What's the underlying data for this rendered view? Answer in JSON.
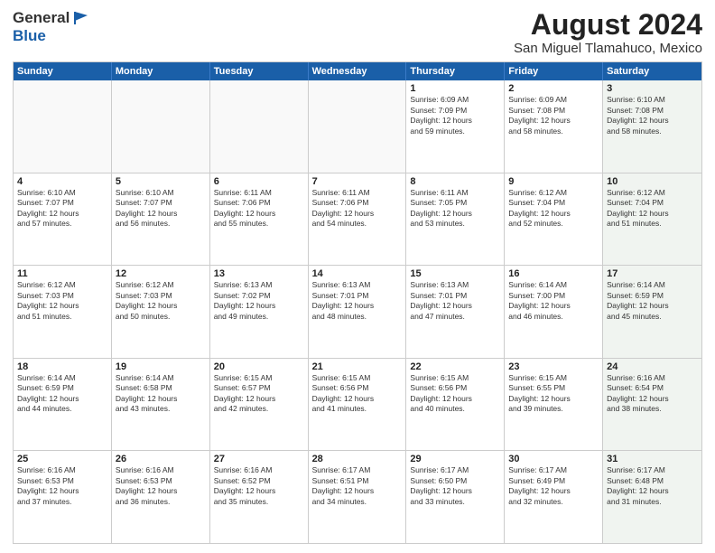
{
  "header": {
    "logo_general": "General",
    "logo_blue": "Blue",
    "main_title": "August 2024",
    "sub_title": "San Miguel Tlamahuco, Mexico"
  },
  "calendar": {
    "days_of_week": [
      "Sunday",
      "Monday",
      "Tuesday",
      "Wednesday",
      "Thursday",
      "Friday",
      "Saturday"
    ],
    "weeks": [
      [
        {
          "day": "",
          "info": "",
          "empty": true
        },
        {
          "day": "",
          "info": "",
          "empty": true
        },
        {
          "day": "",
          "info": "",
          "empty": true
        },
        {
          "day": "",
          "info": "",
          "empty": true
        },
        {
          "day": "1",
          "info": "Sunrise: 6:09 AM\nSunset: 7:09 PM\nDaylight: 12 hours\nand 59 minutes.",
          "empty": false
        },
        {
          "day": "2",
          "info": "Sunrise: 6:09 AM\nSunset: 7:08 PM\nDaylight: 12 hours\nand 58 minutes.",
          "empty": false
        },
        {
          "day": "3",
          "info": "Sunrise: 6:10 AM\nSunset: 7:08 PM\nDaylight: 12 hours\nand 58 minutes.",
          "empty": false,
          "shaded": true
        }
      ],
      [
        {
          "day": "4",
          "info": "Sunrise: 6:10 AM\nSunset: 7:07 PM\nDaylight: 12 hours\nand 57 minutes.",
          "empty": false
        },
        {
          "day": "5",
          "info": "Sunrise: 6:10 AM\nSunset: 7:07 PM\nDaylight: 12 hours\nand 56 minutes.",
          "empty": false
        },
        {
          "day": "6",
          "info": "Sunrise: 6:11 AM\nSunset: 7:06 PM\nDaylight: 12 hours\nand 55 minutes.",
          "empty": false
        },
        {
          "day": "7",
          "info": "Sunrise: 6:11 AM\nSunset: 7:06 PM\nDaylight: 12 hours\nand 54 minutes.",
          "empty": false
        },
        {
          "day": "8",
          "info": "Sunrise: 6:11 AM\nSunset: 7:05 PM\nDaylight: 12 hours\nand 53 minutes.",
          "empty": false
        },
        {
          "day": "9",
          "info": "Sunrise: 6:12 AM\nSunset: 7:04 PM\nDaylight: 12 hours\nand 52 minutes.",
          "empty": false
        },
        {
          "day": "10",
          "info": "Sunrise: 6:12 AM\nSunset: 7:04 PM\nDaylight: 12 hours\nand 51 minutes.",
          "empty": false,
          "shaded": true
        }
      ],
      [
        {
          "day": "11",
          "info": "Sunrise: 6:12 AM\nSunset: 7:03 PM\nDaylight: 12 hours\nand 51 minutes.",
          "empty": false
        },
        {
          "day": "12",
          "info": "Sunrise: 6:12 AM\nSunset: 7:03 PM\nDaylight: 12 hours\nand 50 minutes.",
          "empty": false
        },
        {
          "day": "13",
          "info": "Sunrise: 6:13 AM\nSunset: 7:02 PM\nDaylight: 12 hours\nand 49 minutes.",
          "empty": false
        },
        {
          "day": "14",
          "info": "Sunrise: 6:13 AM\nSunset: 7:01 PM\nDaylight: 12 hours\nand 48 minutes.",
          "empty": false
        },
        {
          "day": "15",
          "info": "Sunrise: 6:13 AM\nSunset: 7:01 PM\nDaylight: 12 hours\nand 47 minutes.",
          "empty": false
        },
        {
          "day": "16",
          "info": "Sunrise: 6:14 AM\nSunset: 7:00 PM\nDaylight: 12 hours\nand 46 minutes.",
          "empty": false
        },
        {
          "day": "17",
          "info": "Sunrise: 6:14 AM\nSunset: 6:59 PM\nDaylight: 12 hours\nand 45 minutes.",
          "empty": false,
          "shaded": true
        }
      ],
      [
        {
          "day": "18",
          "info": "Sunrise: 6:14 AM\nSunset: 6:59 PM\nDaylight: 12 hours\nand 44 minutes.",
          "empty": false
        },
        {
          "day": "19",
          "info": "Sunrise: 6:14 AM\nSunset: 6:58 PM\nDaylight: 12 hours\nand 43 minutes.",
          "empty": false
        },
        {
          "day": "20",
          "info": "Sunrise: 6:15 AM\nSunset: 6:57 PM\nDaylight: 12 hours\nand 42 minutes.",
          "empty": false
        },
        {
          "day": "21",
          "info": "Sunrise: 6:15 AM\nSunset: 6:56 PM\nDaylight: 12 hours\nand 41 minutes.",
          "empty": false
        },
        {
          "day": "22",
          "info": "Sunrise: 6:15 AM\nSunset: 6:56 PM\nDaylight: 12 hours\nand 40 minutes.",
          "empty": false
        },
        {
          "day": "23",
          "info": "Sunrise: 6:15 AM\nSunset: 6:55 PM\nDaylight: 12 hours\nand 39 minutes.",
          "empty": false
        },
        {
          "day": "24",
          "info": "Sunrise: 6:16 AM\nSunset: 6:54 PM\nDaylight: 12 hours\nand 38 minutes.",
          "empty": false,
          "shaded": true
        }
      ],
      [
        {
          "day": "25",
          "info": "Sunrise: 6:16 AM\nSunset: 6:53 PM\nDaylight: 12 hours\nand 37 minutes.",
          "empty": false
        },
        {
          "day": "26",
          "info": "Sunrise: 6:16 AM\nSunset: 6:53 PM\nDaylight: 12 hours\nand 36 minutes.",
          "empty": false
        },
        {
          "day": "27",
          "info": "Sunrise: 6:16 AM\nSunset: 6:52 PM\nDaylight: 12 hours\nand 35 minutes.",
          "empty": false
        },
        {
          "day": "28",
          "info": "Sunrise: 6:17 AM\nSunset: 6:51 PM\nDaylight: 12 hours\nand 34 minutes.",
          "empty": false
        },
        {
          "day": "29",
          "info": "Sunrise: 6:17 AM\nSunset: 6:50 PM\nDaylight: 12 hours\nand 33 minutes.",
          "empty": false
        },
        {
          "day": "30",
          "info": "Sunrise: 6:17 AM\nSunset: 6:49 PM\nDaylight: 12 hours\nand 32 minutes.",
          "empty": false
        },
        {
          "day": "31",
          "info": "Sunrise: 6:17 AM\nSunset: 6:48 PM\nDaylight: 12 hours\nand 31 minutes.",
          "empty": false,
          "shaded": true
        }
      ]
    ]
  }
}
